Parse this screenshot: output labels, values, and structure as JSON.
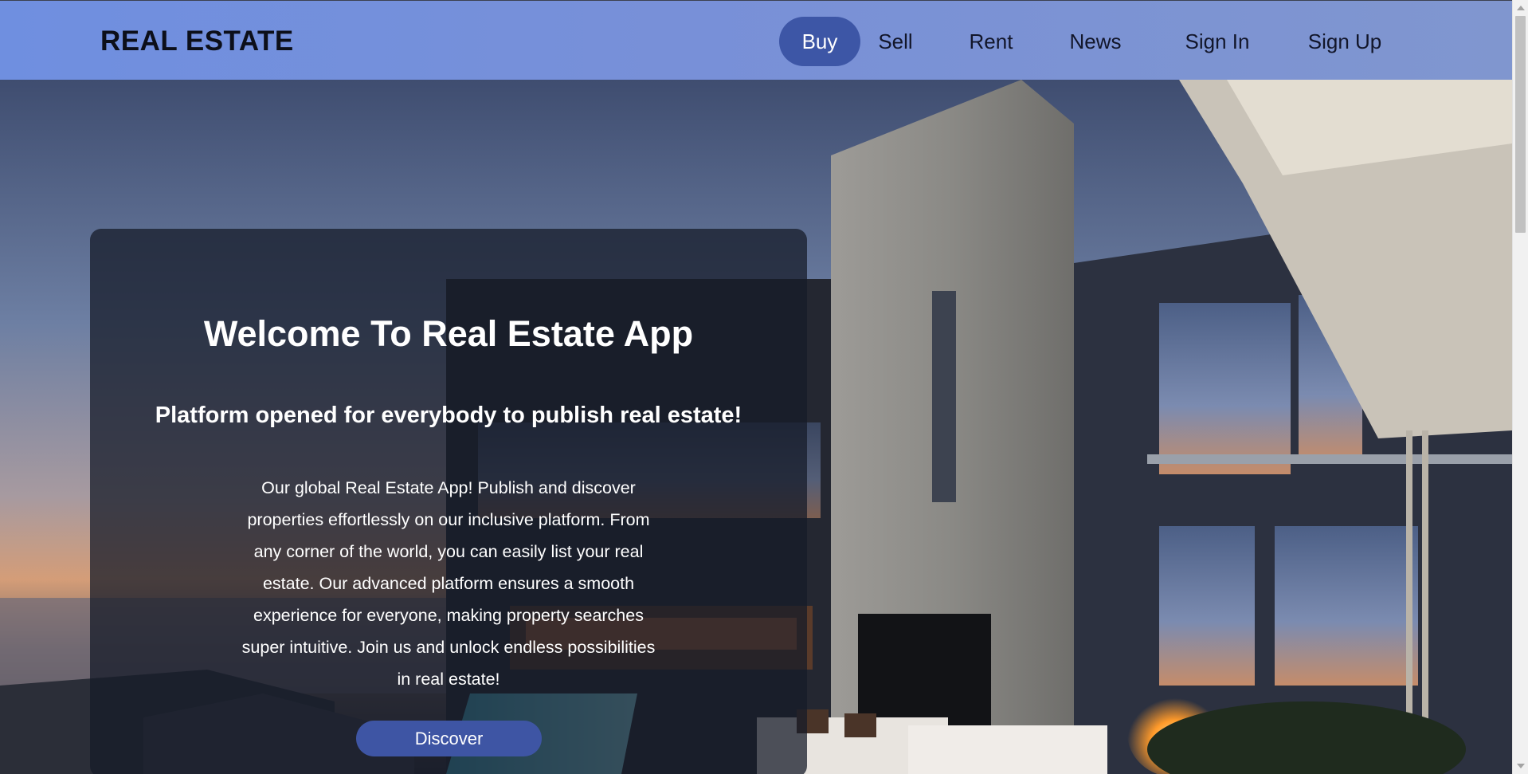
{
  "navbar": {
    "brand": "REAL ESTATE",
    "links": [
      {
        "label": "Buy",
        "active": true
      },
      {
        "label": "Sell",
        "active": false
      },
      {
        "label": "Rent",
        "active": false
      },
      {
        "label": "News",
        "active": false
      },
      {
        "label": "Sign In",
        "active": false
      },
      {
        "label": "Sign Up",
        "active": false
      }
    ]
  },
  "hero": {
    "title": "Welcome To Real Estate App",
    "subtitle": "Platform opened for everybody to publish real estate!",
    "description": "Our global Real Estate App! Publish and discover properties effortlessly on our inclusive platform. From any corner of the world, you can easily list your real estate. Our advanced platform ensures a smooth experience for everyone, making property searches super intuitive. Join us and unlock endless possibilities in real estate!",
    "cta_label": "Discover",
    "background_image": "modern-villa-at-dusk"
  },
  "colors": {
    "navbar_start": "#6f8fe0",
    "navbar_end": "#8096cf",
    "accent": "#3d56a6",
    "card_overlay": "rgba(22,27,40,0.74)",
    "text_light": "#ffffff",
    "text_dark": "#0c0f1a"
  }
}
